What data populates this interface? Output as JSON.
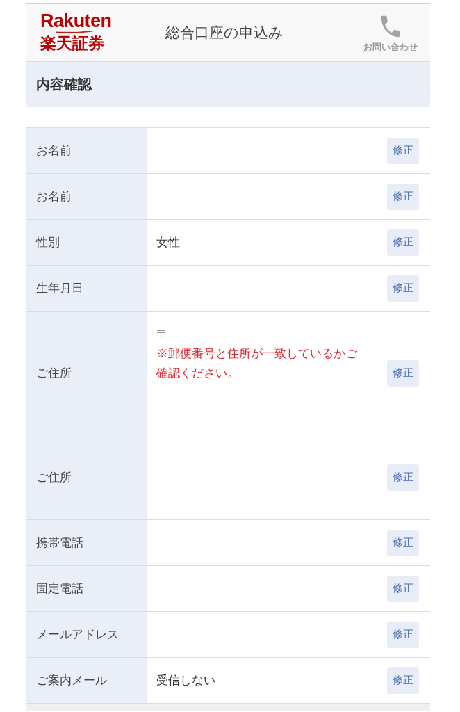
{
  "header": {
    "logo": {
      "wordmark": "Rakuten",
      "name": "楽天証券"
    },
    "title": "総合口座の申込み",
    "contact": {
      "label": "お問い合わせ"
    }
  },
  "section": {
    "title": "内容確認"
  },
  "rows": [
    {
      "kind": "single",
      "label": "お名前",
      "button": "修正"
    },
    {
      "kind": "single",
      "label": "お名前",
      "button": "修正"
    },
    {
      "kind": "single",
      "label": "性別",
      "value": "女性",
      "button": "修正"
    },
    {
      "kind": "single",
      "label": "生年月日",
      "button": "修正"
    },
    {
      "kind": "address",
      "label": "ご住所",
      "value": "〒",
      "note": "※郵便番号と住所が一致しているかご確認ください。",
      "button": "修正"
    },
    {
      "kind": "address",
      "label": "ご住所",
      "button": "修正"
    },
    {
      "kind": "single",
      "label": "携帯電話",
      "button": "修正"
    },
    {
      "kind": "single",
      "label": "固定電話",
      "button": "修正"
    },
    {
      "kind": "single",
      "label": "メールアドレス",
      "button": "修正"
    },
    {
      "kind": "single",
      "label": "ご案内メール",
      "value": "受信しない",
      "button": "修正"
    }
  ]
}
